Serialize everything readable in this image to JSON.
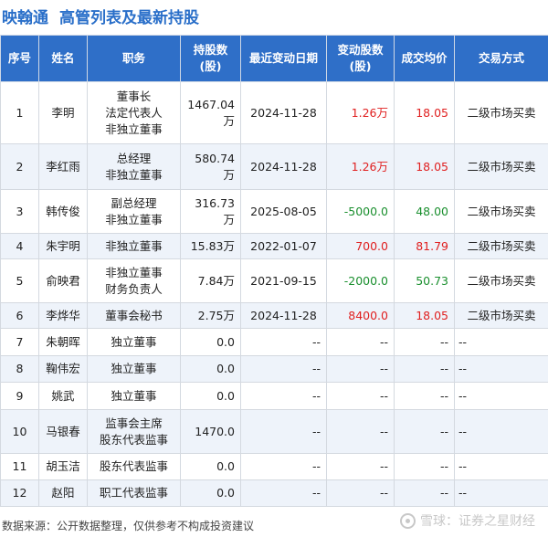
{
  "header": {
    "company": "映翰通",
    "title": "高管列表及最新持股"
  },
  "columns": [
    "序号",
    "姓名",
    "职务",
    "持股数\n(股)",
    "最近变动日期",
    "变动股数\n(股)",
    "成交均价",
    "交易方式"
  ],
  "rows": [
    {
      "no": "1",
      "name": "李明",
      "role": "董事长\n法定代表人\n非独立董事",
      "shares": "1467.04万",
      "date": "2024-11-28",
      "change": "1.26万",
      "change_sign": "pos",
      "price": "18.05",
      "price_sign": "pos",
      "method": "二级市场买卖"
    },
    {
      "no": "2",
      "name": "李红雨",
      "role": "总经理\n非独立董事",
      "shares": "580.74万",
      "date": "2024-11-28",
      "change": "1.26万",
      "change_sign": "pos",
      "price": "18.05",
      "price_sign": "pos",
      "method": "二级市场买卖"
    },
    {
      "no": "3",
      "name": "韩传俊",
      "role": "副总经理\n非独立董事",
      "shares": "316.73万",
      "date": "2025-08-05",
      "change": "-5000.0",
      "change_sign": "neg",
      "price": "48.00",
      "price_sign": "neg",
      "method": "二级市场买卖"
    },
    {
      "no": "4",
      "name": "朱宇明",
      "role": "非独立董事",
      "shares": "15.83万",
      "date": "2022-01-07",
      "change": "700.0",
      "change_sign": "pos",
      "price": "81.79",
      "price_sign": "pos",
      "method": "二级市场买卖"
    },
    {
      "no": "5",
      "name": "俞映君",
      "role": "非独立董事\n财务负责人",
      "shares": "7.84万",
      "date": "2021-09-15",
      "change": "-2000.0",
      "change_sign": "neg",
      "price": "50.73",
      "price_sign": "neg",
      "method": "二级市场买卖"
    },
    {
      "no": "6",
      "name": "李烨华",
      "role": "董事会秘书",
      "shares": "2.75万",
      "date": "2024-11-28",
      "change": "8400.0",
      "change_sign": "pos",
      "price": "18.05",
      "price_sign": "pos",
      "method": "二级市场买卖"
    },
    {
      "no": "7",
      "name": "朱朝晖",
      "role": "独立董事",
      "shares": "0.0",
      "date": "--",
      "change": "--",
      "change_sign": "none",
      "price": "--",
      "price_sign": "none",
      "method": "--"
    },
    {
      "no": "8",
      "name": "鞠伟宏",
      "role": "独立董事",
      "shares": "0.0",
      "date": "--",
      "change": "--",
      "change_sign": "none",
      "price": "--",
      "price_sign": "none",
      "method": "--"
    },
    {
      "no": "9",
      "name": "姚武",
      "role": "独立董事",
      "shares": "0.0",
      "date": "--",
      "change": "--",
      "change_sign": "none",
      "price": "--",
      "price_sign": "none",
      "method": "--"
    },
    {
      "no": "10",
      "name": "马银春",
      "role": "监事会主席\n股东代表监事",
      "shares": "1470.0",
      "date": "--",
      "change": "--",
      "change_sign": "none",
      "price": "--",
      "price_sign": "none",
      "method": "--"
    },
    {
      "no": "11",
      "name": "胡玉洁",
      "role": "股东代表监事",
      "shares": "0.0",
      "date": "--",
      "change": "--",
      "change_sign": "none",
      "price": "--",
      "price_sign": "none",
      "method": "--"
    },
    {
      "no": "12",
      "name": "赵阳",
      "role": "职工代表监事",
      "shares": "0.0",
      "date": "--",
      "change": "--",
      "change_sign": "none",
      "price": "--",
      "price_sign": "none",
      "method": "--"
    }
  ],
  "footer": {
    "source": "数据来源：公开数据整理，仅供参考不构成投资建议",
    "watermark": "雪球：证券之星财经"
  },
  "colors": {
    "header_bg": "#2f6fc8",
    "title": "#2a6fc9",
    "positive": "#e02020",
    "negative": "#1a8f2e",
    "alt_row": "#eef3fa"
  }
}
